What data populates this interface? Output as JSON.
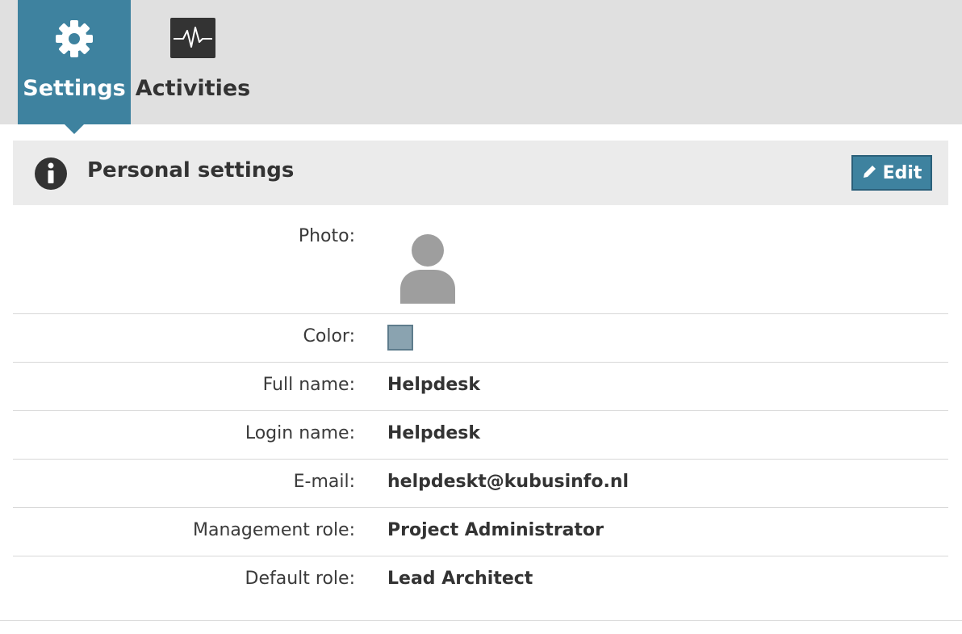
{
  "tabs": [
    {
      "label": "Settings",
      "icon": "gear-icon",
      "active": true
    },
    {
      "label": "Activities",
      "icon": "activity-monitor-icon",
      "active": false
    }
  ],
  "panel": {
    "title": "Personal settings",
    "edit_label": "Edit",
    "icon": "info-icon"
  },
  "fields": {
    "photo": {
      "label": "Photo:",
      "icon": "user-avatar-icon"
    },
    "color": {
      "label": "Color:",
      "value": "#8aa3b0"
    },
    "full_name": {
      "label": "Full name:",
      "value": "Helpdesk"
    },
    "login_name": {
      "label": "Login name:",
      "value": "Helpdesk"
    },
    "email": {
      "label": "E-mail:",
      "value": "helpdeskt@kubusinfo.nl"
    },
    "management_role": {
      "label": "Management role:",
      "value": "Project Administrator"
    },
    "default_role": {
      "label": "Default role:",
      "value": "Lead Architect"
    }
  },
  "colors": {
    "accent": "#3e829f",
    "topbar_bg": "#e0e0e0",
    "header_bg": "#ebebeb"
  }
}
